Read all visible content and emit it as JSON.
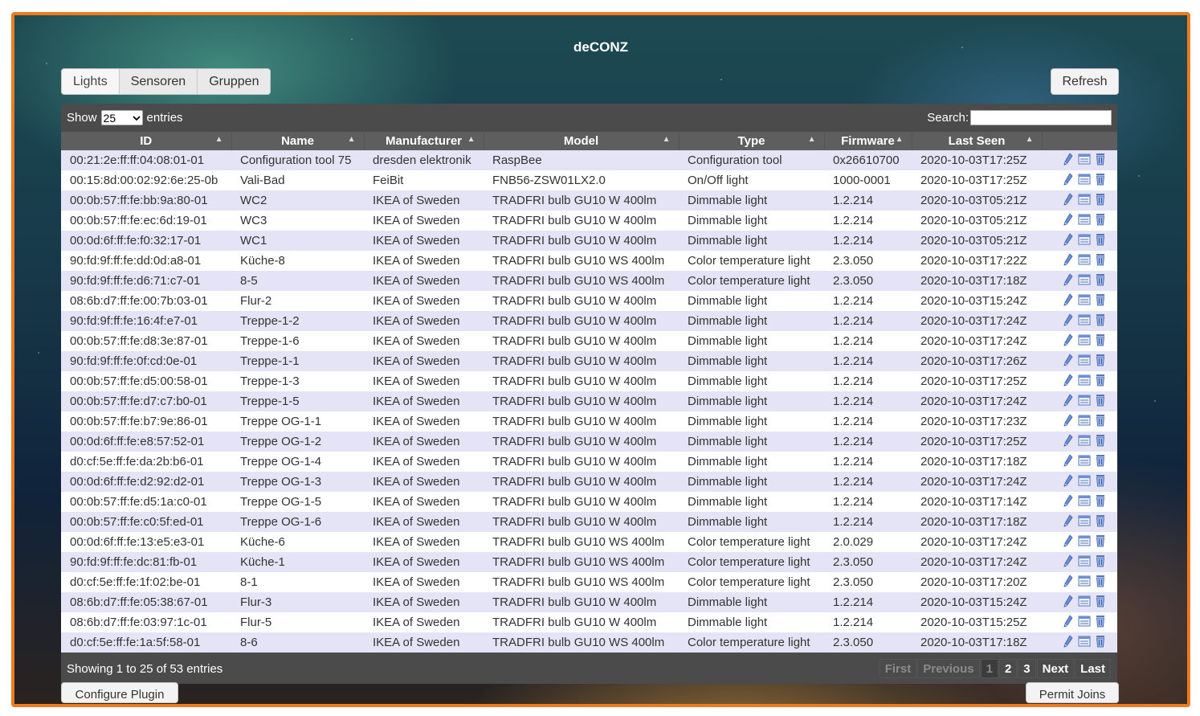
{
  "app": {
    "title": "deCONZ"
  },
  "tabs": [
    {
      "label": "Lights"
    },
    {
      "label": "Sensoren"
    },
    {
      "label": "Gruppen"
    }
  ],
  "toolbar": {
    "refresh_label": "Refresh"
  },
  "table_controls": {
    "show_label": "Show",
    "entries_label": "entries",
    "page_length": "25",
    "search_label": "Search:",
    "search_value": ""
  },
  "columns": [
    "ID",
    "Name",
    "Manufacturer",
    "Model",
    "Type",
    "Firmware",
    "Last Seen"
  ],
  "rows": [
    [
      "00:21:2e:ff:ff:04:08:01-01",
      "Configuration tool 75",
      "dresden elektronik",
      "RaspBee",
      "Configuration tool",
      "0x26610700",
      "2020-10-03T17:25Z"
    ],
    [
      "00:15:8d:00:02:92:6e:25-0b",
      "Vali-Bad",
      "FeiBit",
      "FNB56-ZSW01LX2.0",
      "On/Off light",
      "1000-0001",
      "2020-10-03T17:25Z"
    ],
    [
      "00:0b:57:ff:fe:bb:9a:80-01",
      "WC2",
      "IKEA of Sweden",
      "TRADFRI bulb GU10 W 400lm",
      "Dimmable light",
      "1.2.214",
      "2020-10-03T05:21Z"
    ],
    [
      "00:0b:57:ff:fe:ec:6d:19-01",
      "WC3",
      "IKEA of Sweden",
      "TRADFRI bulb GU10 W 400lm",
      "Dimmable light",
      "1.2.214",
      "2020-10-03T05:21Z"
    ],
    [
      "00:0d:6f:ff:fe:f0:32:17-01",
      "WC1",
      "IKEA of Sweden",
      "TRADFRI bulb GU10 W 400lm",
      "Dimmable light",
      "1.2.214",
      "2020-10-03T05:21Z"
    ],
    [
      "90:fd:9f:ff:fe:dd:0d:a8-01",
      "Küche-8",
      "IKEA of Sweden",
      "TRADFRI bulb GU10 WS 400lm",
      "Color temperature light",
      "2.3.050",
      "2020-10-03T17:22Z"
    ],
    [
      "90:fd:9f:ff:fe:d6:71:c7-01",
      "8-5",
      "IKEA of Sweden",
      "TRADFRI bulb GU10 WS 400lm",
      "Color temperature light",
      "2.3.050",
      "2020-10-03T17:18Z"
    ],
    [
      "08:6b:d7:ff:fe:00:7b:03-01",
      "Flur-2",
      "IKEA of Sweden",
      "TRADFRI bulb GU10 W 400lm",
      "Dimmable light",
      "1.2.214",
      "2020-10-03T15:24Z"
    ],
    [
      "90:fd:9f:ff:fe:16:4f:e7-01",
      "Treppe-1-2",
      "IKEA of Sweden",
      "TRADFRI bulb GU10 W 400lm",
      "Dimmable light",
      "1.2.214",
      "2020-10-03T17:24Z"
    ],
    [
      "00:0b:57:ff:fe:d8:3e:87-01",
      "Treppe-1-6",
      "IKEA of Sweden",
      "TRADFRI bulb GU10 W 400lm",
      "Dimmable light",
      "1.2.214",
      "2020-10-03T17:24Z"
    ],
    [
      "90:fd:9f:ff:fe:0f:cd:0e-01",
      "Treppe-1-1",
      "IKEA of Sweden",
      "TRADFRI bulb GU10 W 400lm",
      "Dimmable light",
      "1.2.214",
      "2020-10-03T17:26Z"
    ],
    [
      "00:0b:57:ff:fe:d5:00:58-01",
      "Treppe-1-3",
      "IKEA of Sweden",
      "TRADFRI bulb GU10 W 400lm",
      "Dimmable light",
      "1.2.214",
      "2020-10-03T17:25Z"
    ],
    [
      "00:0b:57:ff:fe:d7:c7:b0-01",
      "Treppe-1-5",
      "IKEA of Sweden",
      "TRADFRI bulb GU10 W 400lm",
      "Dimmable light",
      "1.2.214",
      "2020-10-03T17:24Z"
    ],
    [
      "00:0b:57:ff:fe:b7:9e:86-01",
      "Treppe OG-1-1",
      "IKEA of Sweden",
      "TRADFRI bulb GU10 W 400lm",
      "Dimmable light",
      "1.2.214",
      "2020-10-03T17:23Z"
    ],
    [
      "00:0d:6f:ff:fe:e8:57:52-01",
      "Treppe OG-1-2",
      "IKEA of Sweden",
      "TRADFRI bulb GU10 W 400lm",
      "Dimmable light",
      "1.2.214",
      "2020-10-03T17:25Z"
    ],
    [
      "d0:cf:5e:ff:fe:da:2b:b6-01",
      "Treppe OG-1-4",
      "IKEA of Sweden",
      "TRADFRI bulb GU10 W 400lm",
      "Dimmable light",
      "1.2.214",
      "2020-10-03T17:18Z"
    ],
    [
      "00:0d:6f:ff:fe:d2:92:d2-01",
      "Treppe OG-1-3",
      "IKEA of Sweden",
      "TRADFRI bulb GU10 W 400lm",
      "Dimmable light",
      "1.2.214",
      "2020-10-03T17:24Z"
    ],
    [
      "00:0b:57:ff:fe:d5:1a:c0-01",
      "Treppe OG-1-5",
      "IKEA of Sweden",
      "TRADFRI bulb GU10 W 400lm",
      "Dimmable light",
      "1.2.214",
      "2020-10-03T17:14Z"
    ],
    [
      "00:0b:57:ff:fe:c0:5f:ed-01",
      "Treppe OG-1-6",
      "IKEA of Sweden",
      "TRADFRI bulb GU10 W 400lm",
      "Dimmable light",
      "1.2.214",
      "2020-10-03T17:18Z"
    ],
    [
      "00:0d:6f:ff:fe:13:e5:e3-01",
      "Küche-6",
      "IKEA of Sweden",
      "TRADFRI bulb GU10 WS 400lm",
      "Color temperature light",
      "2.0.029",
      "2020-10-03T17:24Z"
    ],
    [
      "90:fd:9f:ff:fe:dc:81:fb-01",
      "Küche-1",
      "IKEA of Sweden",
      "TRADFRI bulb GU10 WS 400lm",
      "Color temperature light",
      "2.3.050",
      "2020-10-03T17:24Z"
    ],
    [
      "d0:cf:5e:ff:fe:1f:02:be-01",
      "8-1",
      "IKEA of Sweden",
      "TRADFRI bulb GU10 WS 400lm",
      "Color temperature light",
      "2.3.050",
      "2020-10-03T17:20Z"
    ],
    [
      "08:6b:d7:ff:fe:05:38:67-01",
      "Flur-3",
      "IKEA of Sweden",
      "TRADFRI bulb GU10 W 400lm",
      "Dimmable light",
      "1.2.214",
      "2020-10-03T15:24Z"
    ],
    [
      "08:6b:d7:ff:fe:03:97:1c-01",
      "Flur-5",
      "IKEA of Sweden",
      "TRADFRI bulb GU10 W 400lm",
      "Dimmable light",
      "1.2.214",
      "2020-10-03T15:25Z"
    ],
    [
      "d0:cf:5e:ff:fe:1a:5f:58-01",
      "8-6",
      "IKEA of Sweden",
      "TRADFRI bulb GU10 WS 400lm",
      "Color temperature light",
      "2.3.050",
      "2020-10-03T17:18Z"
    ]
  ],
  "row_icons": [
    "edit-icon",
    "details-icon",
    "delete-icon"
  ],
  "footer": {
    "info": "Showing 1 to 25 of 53 entries",
    "pagination": [
      {
        "label": "First",
        "state": "disabled"
      },
      {
        "label": "Previous",
        "state": "disabled"
      },
      {
        "label": "1",
        "state": "current"
      },
      {
        "label": "2",
        "state": "active"
      },
      {
        "label": "3",
        "state": "active"
      },
      {
        "label": "Next",
        "state": "active"
      },
      {
        "label": "Last",
        "state": "active"
      }
    ]
  },
  "bottom_buttons": {
    "left_label": "Configure Plugin",
    "right_label": "Permit Joins"
  },
  "colors": {
    "frame_border": "#f07a1e",
    "panel_bg": "#4b4b4b",
    "header_bg": "#5e5e5e",
    "row_odd": "#e4e4f6",
    "row_even": "#ffffff"
  }
}
